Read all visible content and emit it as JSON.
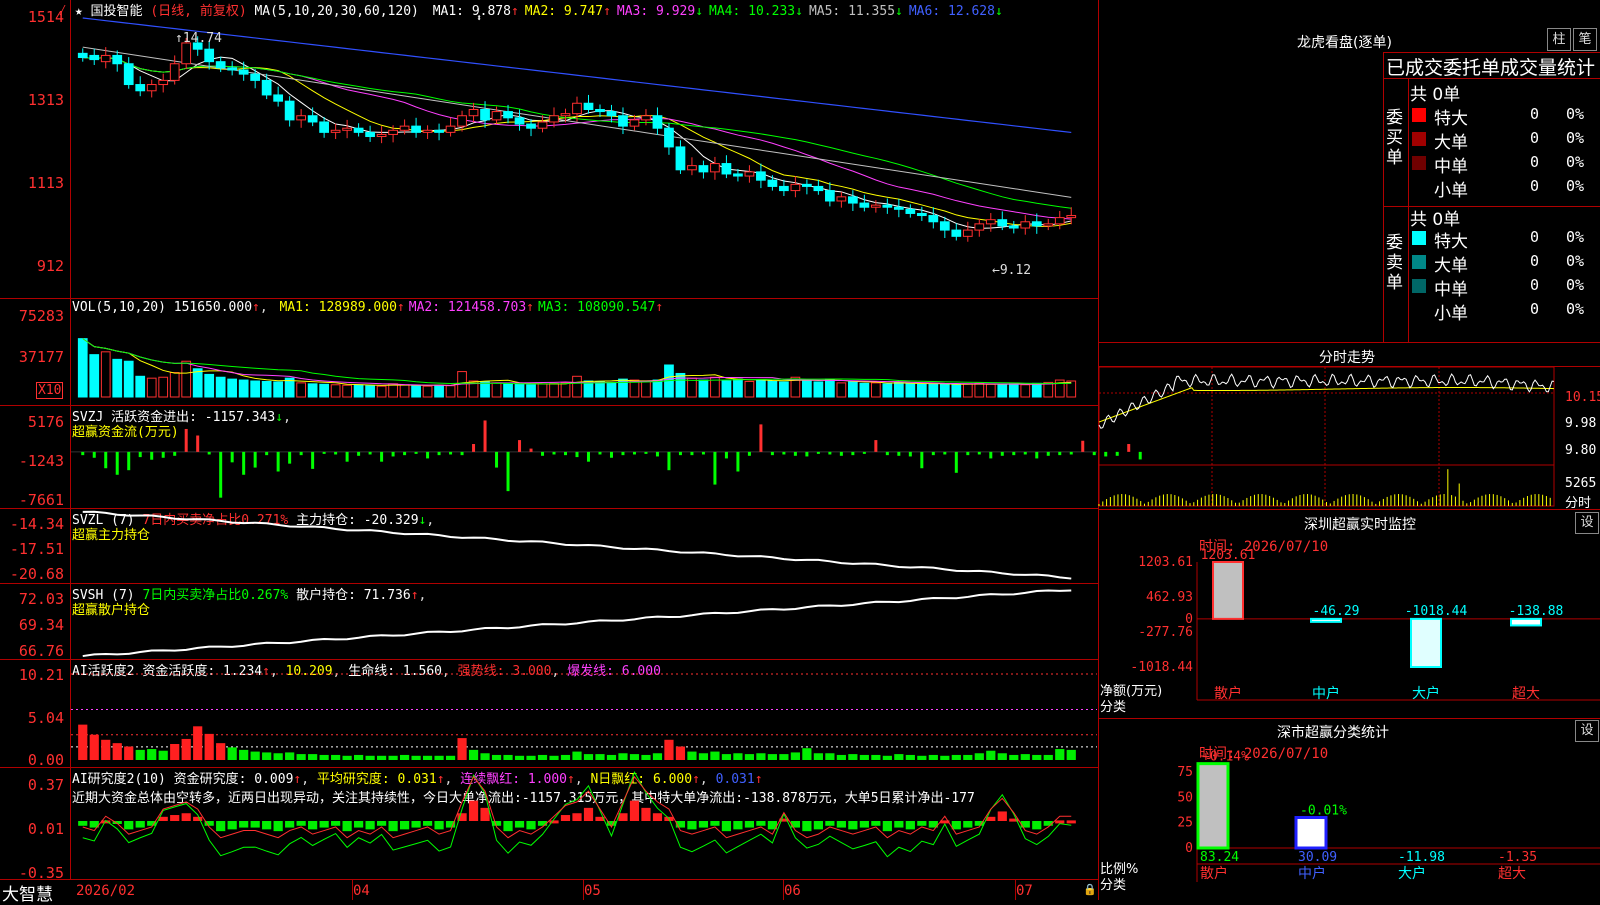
{
  "brand": "大智慧",
  "header": {
    "star": "★",
    "stock_name": "国投智能",
    "period": "(日线, 前复权)",
    "ma_label": "MA(5,10,20,30,60,120)",
    "ma": [
      {
        "name": "MA1:",
        "value": "9.878",
        "arrow": "↑",
        "color": "#ffffff"
      },
      {
        "name": "MA2:",
        "value": "9.747",
        "arrow": "↑",
        "color": "#ffff00"
      },
      {
        "name": "MA3:",
        "value": "9.929",
        "arrow": "↓",
        "color": "#ff40ff"
      },
      {
        "name": "MA4:",
        "value": "10.233",
        "arrow": "↓",
        "color": "#00ff00"
      },
      {
        "name": "MA5:",
        "value": "11.355",
        "arrow": "↓",
        "color": "#c0c0c0"
      },
      {
        "name": "MA6:",
        "value": "12.628",
        "arrow": "↓",
        "color": "#4060ff"
      }
    ]
  },
  "price_axis": [
    "1514",
    "1313",
    "1113",
    "912"
  ],
  "price_annotations": {
    "high": "14.74",
    "low": "9.12"
  },
  "vol_panel": {
    "label": "VOL(5,10,20)",
    "value": "151650.000",
    "arrow": "↑",
    "ma": [
      {
        "name": "MA1:",
        "value": "128989.000",
        "arrow": "↑",
        "color": "#ffff00"
      },
      {
        "name": "MA2:",
        "value": "121458.703",
        "arrow": "↑",
        "color": "#ff40ff"
      },
      {
        "name": "MA3:",
        "value": "108090.547",
        "arrow": "↑",
        "color": "#00ff00"
      }
    ],
    "axis": [
      "75283",
      "37177"
    ],
    "unit": "X10"
  },
  "svzj_panel": {
    "label": "SVZJ",
    "name": "活跃资金进出:",
    "value": "-1157.343",
    "arrow": "↓",
    "sub": "超赢资金流(万元)",
    "axis": [
      "5176",
      "-1243",
      "-7661"
    ]
  },
  "svzl_panel": {
    "label": "SVZL (7)",
    "ratio": "7日内买卖净占比0.271%",
    "name": "主力持仓:",
    "value": "-20.329",
    "arrow": "↓",
    "sub": "超赢主力持仓",
    "axis": [
      "-14.34",
      "-17.51",
      "-20.68"
    ]
  },
  "svsh_panel": {
    "label": "SVSH (7)",
    "ratio": "7日内买卖净占比0.267%",
    "name": "散户持仓:",
    "value": "71.736",
    "arrow": "↑",
    "sub": "超赢散户持仓",
    "axis": [
      "72.03",
      "69.34",
      "66.76"
    ]
  },
  "ai_act_panel": {
    "label": "AI活跃度2",
    "name": "资金活跃度:",
    "value": "1.234",
    "arrow": "↑",
    "v2": "10.209",
    "life": "生命线: 1.560",
    "strong": "强势线: 3.000",
    "burst": "爆发线: 6.000",
    "axis": [
      "10.21",
      "5.04",
      "0.00"
    ]
  },
  "ai_res_panel": {
    "label": "AI研究度2(10)",
    "name": "资金研究度:",
    "value": "0.009",
    "avg": "平均研究度: 0.031",
    "lianxu": "连续飘红: 1.000",
    "nri": "N日飘红: 6.000",
    "extra": "0.031",
    "comment": "近期大资金总体由空转多，近两日出现异动，关注其持续性，今日大单净流出:-1157.315万元，其中特大单净流出:-138.878万元，大单5日累计净出-177",
    "axis": [
      "0.37",
      "0.01",
      "-0.35"
    ]
  },
  "date_axis": [
    "2026/02",
    "04",
    "05",
    "06",
    "07"
  ],
  "right_panel": {
    "title": "龙虎看盘(逐单)",
    "btn1": "柱",
    "btn2": "笔",
    "section_title": "已成交委托单成交量统计",
    "buy": {
      "side": "委买单",
      "count": "共 0单",
      "rows": [
        {
          "name": "特大",
          "vol": "0",
          "pct": "0%",
          "color": "#ff0000"
        },
        {
          "name": "大单",
          "vol": "0",
          "pct": "0%",
          "color": "#a00000"
        },
        {
          "name": "中单",
          "vol": "0",
          "pct": "0%",
          "color": "#700000"
        },
        {
          "name": "小单",
          "vol": "0",
          "pct": "0%",
          "color": ""
        }
      ]
    },
    "sell": {
      "side": "委卖单",
      "count": "共 0单",
      "rows": [
        {
          "name": "特大",
          "vol": "0",
          "pct": "0%",
          "color": "#00ffff"
        },
        {
          "name": "大单",
          "vol": "0",
          "pct": "0%",
          "color": "#008888"
        },
        {
          "name": "中单",
          "vol": "0",
          "pct": "0%",
          "color": "#006666"
        },
        {
          "name": "小单",
          "vol": "0",
          "pct": "0%",
          "color": ""
        }
      ]
    },
    "minute_title": "分时走势",
    "minute_axis": [
      "10.15",
      "9.98",
      "9.80"
    ],
    "minute_vol_axis": [
      "5265",
      "分时"
    ],
    "monitor_title": "深圳超赢实时监控",
    "monitor_btn": "设",
    "monitor_time": "时间: 2026/07/10",
    "monitor_axis": [
      "1203.61",
      "462.93",
      "0",
      "-277.76",
      "-1018.44"
    ],
    "monitor_unit": [
      "净额(万元)",
      "分类"
    ],
    "classify_title": "深市超赢分类统计",
    "classify_btn": "设",
    "classify_time": "时间: 2026/07/10",
    "classify_axis": [
      "75",
      "50",
      "25",
      "0"
    ],
    "classify_unit": [
      "比例%",
      "分类"
    ]
  },
  "chart_data": [
    {
      "type": "candlestick",
      "title": "国投智能 日线",
      "ylim": [
        9.0,
        15.3
      ],
      "closes": [
        14.35,
        14.3,
        14.4,
        14.2,
        13.7,
        13.55,
        13.7,
        13.8,
        14.2,
        14.7,
        14.55,
        14.25,
        14.1,
        14.05,
        13.95,
        13.8,
        13.45,
        13.3,
        12.85,
        12.95,
        12.8,
        12.55,
        12.6,
        12.65,
        12.55,
        12.45,
        12.5,
        12.6,
        12.7,
        12.55,
        12.6,
        12.55,
        12.7,
        12.95,
        13.1,
        12.85,
        13.05,
        12.9,
        12.75,
        12.65,
        12.8,
        12.95,
        13.0,
        13.25,
        13.1,
        13.05,
        12.95,
        12.7,
        12.85,
        12.95,
        12.65,
        12.2,
        11.65,
        11.75,
        11.6,
        11.8,
        11.55,
        11.5,
        11.6,
        11.4,
        11.25,
        11.15,
        11.3,
        11.25,
        11.15,
        10.9,
        11.0,
        10.85,
        10.75,
        10.8,
        10.75,
        10.7,
        10.6,
        10.55,
        10.4,
        10.2,
        10.05,
        10.2,
        10.35,
        10.45,
        10.3,
        10.25,
        10.4,
        10.3,
        10.35,
        10.5,
        10.55
      ],
      "opens": [
        14.45,
        14.4,
        14.25,
        14.4,
        14.2,
        13.7,
        13.55,
        13.7,
        13.8,
        14.2,
        14.7,
        14.55,
        14.25,
        14.1,
        14.05,
        13.95,
        13.8,
        13.45,
        13.3,
        12.85,
        12.95,
        12.8,
        12.55,
        12.6,
        12.65,
        12.55,
        12.45,
        12.5,
        12.6,
        12.7,
        12.55,
        12.6,
        12.55,
        12.7,
        12.95,
        13.1,
        12.85,
        13.05,
        12.9,
        12.75,
        12.65,
        12.8,
        12.95,
        13.0,
        13.25,
        13.1,
        13.05,
        12.95,
        12.7,
        12.85,
        12.95,
        12.65,
        12.2,
        11.65,
        11.75,
        11.6,
        11.8,
        11.55,
        11.5,
        11.6,
        11.4,
        11.25,
        11.15,
        11.3,
        11.25,
        11.15,
        10.9,
        11.0,
        10.85,
        10.75,
        10.8,
        10.75,
        10.7,
        10.6,
        10.55,
        10.4,
        10.2,
        10.05,
        10.2,
        10.35,
        10.45,
        10.3,
        10.25,
        10.4,
        10.3,
        10.35,
        10.5
      ]
    },
    {
      "type": "bar",
      "title": "VOL(5,10,20)",
      "ylim": [
        0,
        85000
      ],
      "values": [
        62000,
        45000,
        48000,
        40000,
        38000,
        22000,
        20000,
        21000,
        26000,
        38000,
        30000,
        24000,
        21000,
        19000,
        18000,
        17000,
        16500,
        16000,
        20000,
        15000,
        14000,
        13500,
        13000,
        12500,
        13000,
        12000,
        11500,
        14000,
        13000,
        12000,
        11500,
        12500,
        12000,
        27000,
        17000,
        16000,
        15000,
        14000,
        13500,
        13000,
        14000,
        14500,
        15000,
        22000,
        17000,
        16000,
        15500,
        19000,
        18000,
        17000,
        18000,
        34000,
        25000,
        20000,
        18000,
        21000,
        17000,
        19000,
        16500,
        18000,
        17000,
        16000,
        21000,
        17500,
        16000,
        19000,
        15000,
        16000,
        14500,
        15000,
        14000,
        15500,
        14000,
        13500,
        14000,
        13500,
        13000,
        14000,
        14500,
        13500,
        13000,
        14000,
        13000,
        14500,
        15500,
        18000,
        17000
      ]
    },
    {
      "type": "bar",
      "title": "超赢资金流(万元)",
      "ylim": [
        -7661,
        5176
      ],
      "values": [
        -500,
        -900,
        -2500,
        -3500,
        -2800,
        -800,
        -1200,
        -900,
        -600,
        3500,
        2500,
        -400,
        -7000,
        -1600,
        -3500,
        -2400,
        -500,
        -3000,
        -1800,
        -500,
        -2600,
        -300,
        -400,
        -1500,
        -600,
        -400,
        -1500,
        -700,
        -500,
        -300,
        -1000,
        -500,
        -400,
        -500,
        1200,
        4800,
        -2400,
        -6000,
        1800,
        500,
        -600,
        -400,
        -500,
        -800,
        -1500,
        -400,
        -900,
        -500,
        -400,
        -300,
        -700,
        -2800,
        -500,
        -500,
        -400,
        -5000,
        -1000,
        -3000,
        -600,
        4200,
        -500,
        -400,
        -600,
        -700,
        -300,
        -400,
        -600,
        -500,
        -300,
        1800,
        -500,
        -600,
        -700,
        -2500,
        -500,
        -400,
        -3200,
        -500,
        -400,
        -1000,
        -600,
        -500,
        -400,
        -1000,
        -600,
        -500,
        -400,
        1700,
        -500,
        -700,
        -600,
        1200,
        -1157
      ]
    },
    {
      "type": "line",
      "title": "超赢主力持仓",
      "ylim": [
        -20.68,
        -14.34
      ]
    },
    {
      "type": "line",
      "title": "超赢散户持仓",
      "ylim": [
        66.76,
        72.03
      ]
    },
    {
      "type": "bar",
      "title": "AI活跃度2",
      "ylim": [
        0,
        10.21
      ],
      "values": [
        4.2,
        3.0,
        2.4,
        2.0,
        1.6,
        1.2,
        1.3,
        1.1,
        1.9,
        2.5,
        4.0,
        3.1,
        2.0,
        1.5,
        1.2,
        1.0,
        0.9,
        0.8,
        0.9,
        0.7,
        0.7,
        0.6,
        0.6,
        0.5,
        0.6,
        0.5,
        0.5,
        0.5,
        0.6,
        0.5,
        0.5,
        0.5,
        0.5,
        2.6,
        1.2,
        0.8,
        0.6,
        0.6,
        0.5,
        0.5,
        0.6,
        0.5,
        0.6,
        1.0,
        0.7,
        0.7,
        0.6,
        0.8,
        0.7,
        0.6,
        0.8,
        2.4,
        1.6,
        1.0,
        0.8,
        1.0,
        0.7,
        0.8,
        0.7,
        0.8,
        0.7,
        0.7,
        0.9,
        1.4,
        0.8,
        0.8,
        0.6,
        0.7,
        0.6,
        0.6,
        0.5,
        0.7,
        0.6,
        0.5,
        0.6,
        0.5,
        0.6,
        0.6,
        0.8,
        1.1,
        0.8,
        0.6,
        0.7,
        0.6,
        0.6,
        1.3,
        1.2
      ]
    },
    {
      "type": "bar",
      "title": "AI研究度2(10)",
      "ylim": [
        -0.35,
        0.37
      ],
      "values": [
        -0.02,
        -0.03,
        0.01,
        -0.01,
        -0.04,
        -0.03,
        -0.02,
        0.03,
        0.04,
        0.05,
        0.03,
        -0.02,
        -0.05,
        -0.04,
        -0.03,
        -0.03,
        -0.04,
        -0.05,
        -0.03,
        -0.02,
        -0.04,
        -0.03,
        -0.02,
        -0.05,
        -0.03,
        -0.04,
        -0.02,
        -0.05,
        -0.04,
        -0.03,
        -0.02,
        -0.04,
        -0.03,
        0.05,
        0.12,
        0.08,
        -0.02,
        -0.05,
        -0.03,
        -0.04,
        -0.02,
        0.01,
        0.04,
        0.05,
        0.08,
        0.03,
        -0.02,
        0.05,
        0.12,
        0.08,
        0.05,
        0.03,
        -0.03,
        -0.04,
        -0.03,
        -0.02,
        -0.05,
        -0.04,
        -0.03,
        -0.02,
        -0.04,
        0.02,
        -0.03,
        -0.05,
        -0.04,
        -0.02,
        -0.03,
        -0.04,
        -0.03,
        -0.02,
        -0.05,
        -0.03,
        -0.04,
        -0.02,
        -0.03,
        0.01,
        -0.04,
        -0.03,
        -0.02,
        0.03,
        0.06,
        0.02,
        -0.03,
        -0.04,
        -0.02,
        0.01,
        0.01
      ]
    },
    {
      "type": "bar",
      "title": "深圳超赢实时监控",
      "categories": [
        "散户",
        "中户",
        "大户",
        "超大"
      ],
      "values": [
        1203.61,
        -46.29,
        -1018.44,
        -138.88
      ],
      "ylim": [
        -1018.44,
        1203.61
      ]
    },
    {
      "type": "bar",
      "title": "深市超赢分类统计",
      "categories": [
        "散户",
        "中户",
        "大户",
        "超大"
      ],
      "values": [
        83.24,
        30.09,
        -11.98,
        -1.35
      ],
      "top_labels": [
        "+0.14%",
        "-0.01%",
        "",
        ""
      ],
      "ylim": [
        0,
        75
      ]
    }
  ]
}
